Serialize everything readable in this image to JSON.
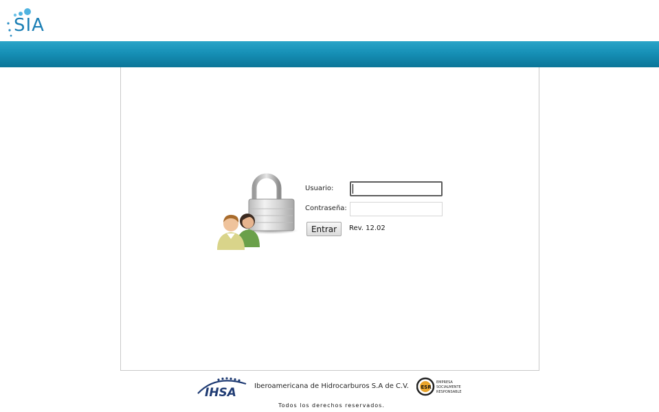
{
  "header": {
    "logo_text": "SIA",
    "logo_icon": "sia-logo",
    "brand_color": "#1b7fb5",
    "banner_color": "#1690b6"
  },
  "login": {
    "illustration_icon": "users-lock-icon",
    "username_label": "Usuario:",
    "username_value": "",
    "password_label": "Contraseña:",
    "password_value": "",
    "submit_label": "Entrar",
    "revision": "Rev. 12.02"
  },
  "footer": {
    "ihsa_logo_text": "IHSA",
    "company_name": "Iberoamericana de Hidrocarburos S.A de C.V.",
    "esr_logo_text": "ESR",
    "esr_lines": [
      "EMPRESA",
      "SOCIALMENTE",
      "RESPONSABLE"
    ],
    "rights": "Todos los derechos reservados."
  }
}
